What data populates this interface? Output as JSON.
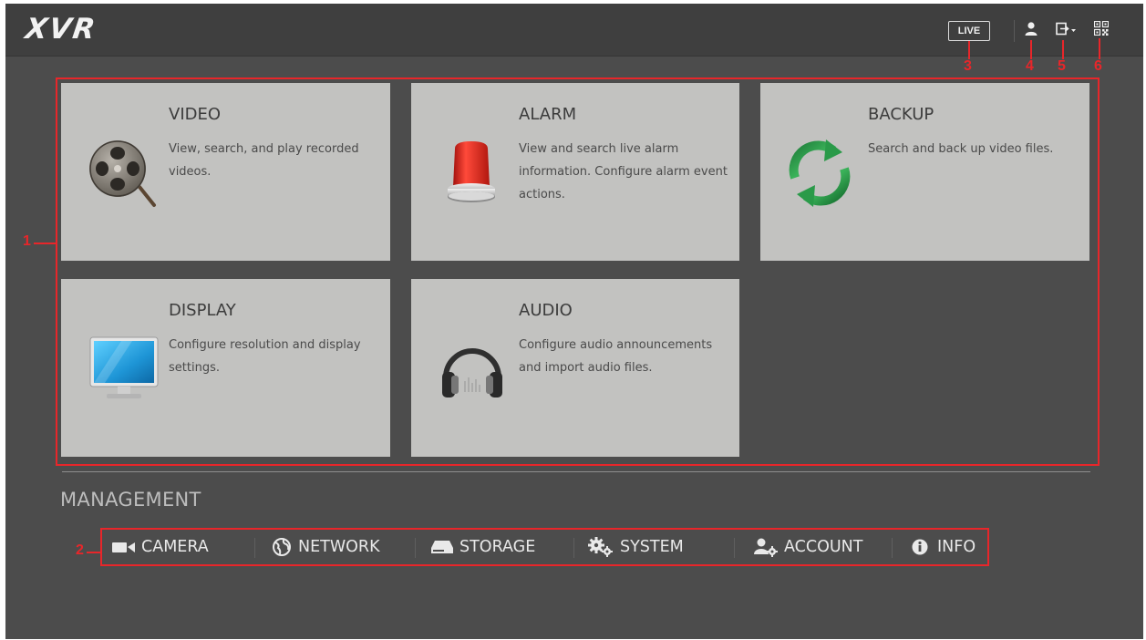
{
  "app": {
    "logo": "XVR"
  },
  "topbar": {
    "live_label": "LIVE",
    "user_icon": "user-icon",
    "logout_icon": "logout-icon",
    "qr_icon": "qrcode-icon"
  },
  "tiles": [
    {
      "title": "VIDEO",
      "description": "View, search, and play recorded videos.",
      "icon": "film-reel-icon"
    },
    {
      "title": "ALARM",
      "description": "View and search live alarm information. Configure alarm event actions.",
      "icon": "siren-icon"
    },
    {
      "title": "BACKUP",
      "description": "Search and back up video files.",
      "icon": "sync-icon"
    },
    {
      "title": "DISPLAY",
      "description": "Configure resolution and display settings.",
      "icon": "monitor-icon"
    },
    {
      "title": "AUDIO",
      "description": "Configure audio announcements and import audio files.",
      "icon": "headphones-icon"
    }
  ],
  "management": {
    "title": "MANAGEMENT",
    "items": [
      {
        "label": "CAMERA",
        "icon": "camera-icon"
      },
      {
        "label": "NETWORK",
        "icon": "globe-icon"
      },
      {
        "label": "STORAGE",
        "icon": "hdd-icon"
      },
      {
        "label": "SYSTEM",
        "icon": "gears-icon"
      },
      {
        "label": "ACCOUNT",
        "icon": "user-gear-icon"
      },
      {
        "label": "INFO",
        "icon": "info-icon"
      }
    ]
  },
  "annotations": {
    "n1": "1",
    "n2": "2",
    "n3": "3",
    "n4": "4",
    "n5": "5",
    "n6": "6"
  },
  "colors": {
    "annotation": "#e8262a",
    "tile": "#c2c2c0",
    "background": "#4c4c4c"
  }
}
